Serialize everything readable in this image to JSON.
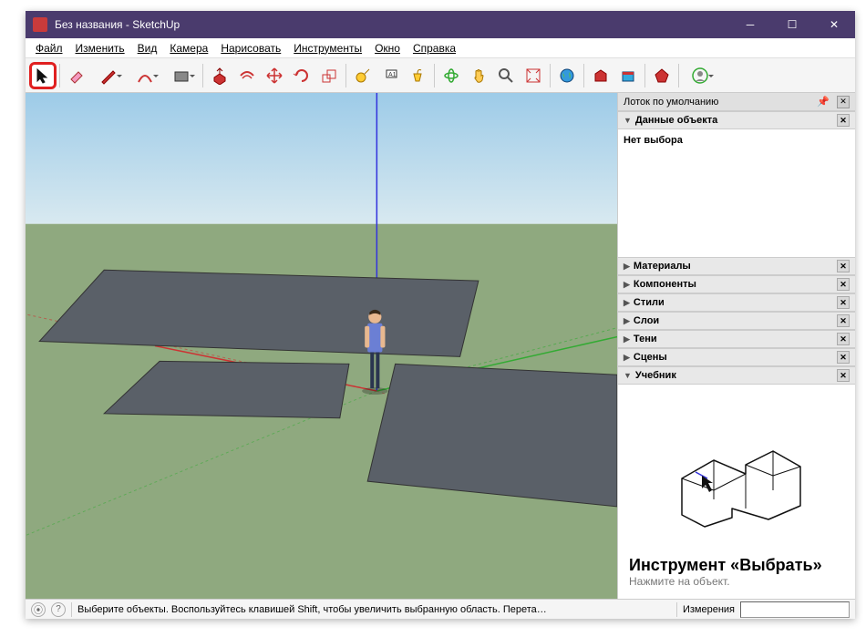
{
  "window": {
    "title": "Без названия - SketchUp"
  },
  "menu": {
    "file": "Файл",
    "edit": "Изменить",
    "view": "Вид",
    "camera": "Камера",
    "draw": "Нарисовать",
    "tools": "Инструменты",
    "window": "Окно",
    "help": "Справка"
  },
  "tray": {
    "title": "Лоток по умолчанию",
    "entity_info": "Данные объекта",
    "no_selection": "Нет выбора",
    "materials": "Материалы",
    "components": "Компоненты",
    "styles": "Стили",
    "layers": "Слои",
    "shadows": "Тени",
    "scenes": "Сцены",
    "instructor": "Учебник"
  },
  "tutorial": {
    "title": "Инструмент «Выбрать»",
    "subtitle": "Нажмите на объект."
  },
  "status": {
    "message": "Выберите объекты. Воспользуйтесь клавишей Shift, чтобы увеличить выбранную область. Перета…",
    "measurements_label": "Измерения"
  }
}
